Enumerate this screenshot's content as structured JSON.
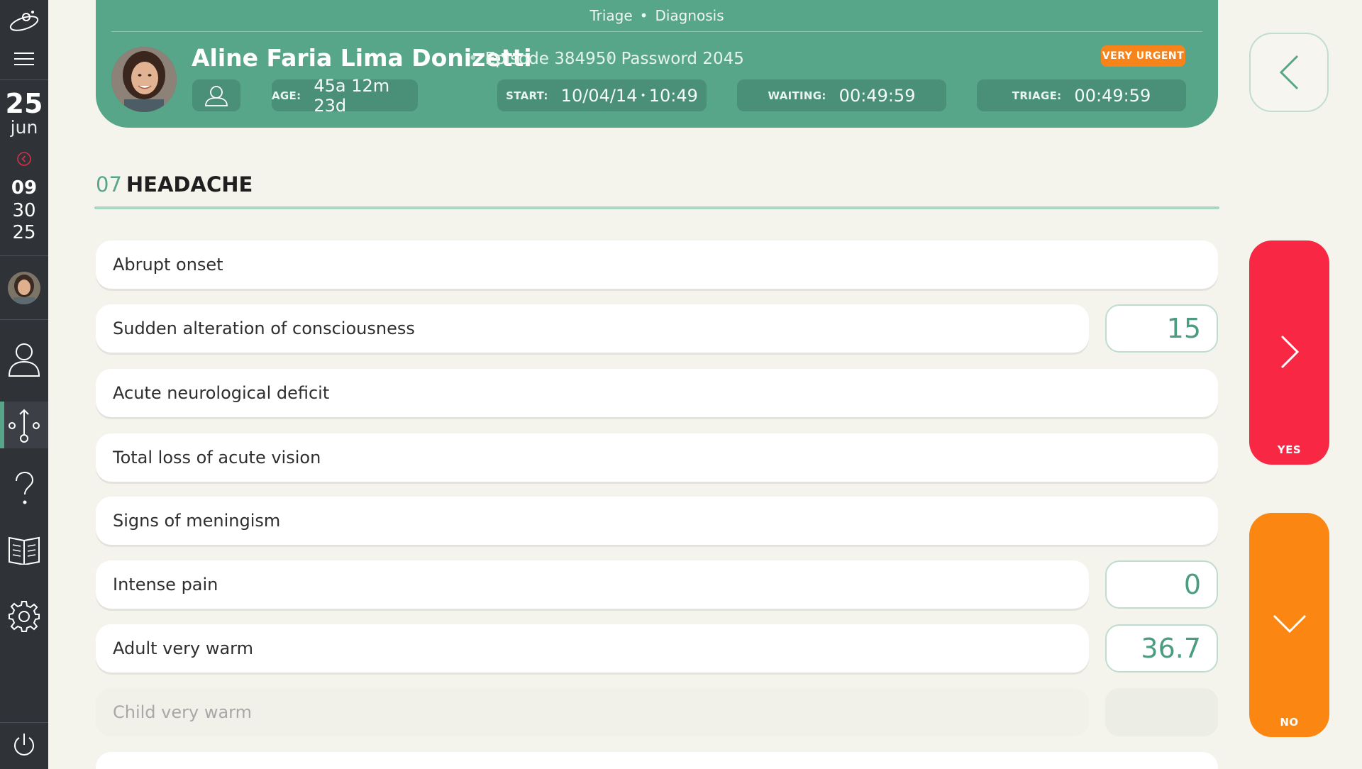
{
  "sidebar": {
    "date": {
      "day": "25",
      "month": "jun"
    },
    "time": {
      "hours": "09",
      "minutes": "30",
      "seconds": "25"
    }
  },
  "header": {
    "breadcrumb": {
      "part1": "Triage",
      "separator": "•",
      "part2": "Diagnosis"
    },
    "patient_name": "Aline Faria Lima Donizetti",
    "episode": "Episode 384950",
    "password": "Password 2045",
    "separator": "•",
    "urgency": "VERY URGENT",
    "age_label": "AGE:",
    "age_value": "45a 12m 23d",
    "start_label": "START:",
    "start_date": "10/04/14",
    "start_sep": "•",
    "start_time": "10:49",
    "waiting_label": "WAITING:",
    "waiting_value": "00:49:59",
    "triage_label": "TRIAGE:",
    "triage_value": "00:49:59"
  },
  "section": {
    "number": "07",
    "title": "HEADACHE"
  },
  "criteria": [
    {
      "label": "Abrupt onset"
    },
    {
      "label": "Sudden alteration of consciousness",
      "value": "15"
    },
    {
      "label": "Acute neurological deficit"
    },
    {
      "label": "Total loss of acute vision"
    },
    {
      "label": "Signs of meningism"
    },
    {
      "label": "Intense pain",
      "value": "0"
    },
    {
      "label": "Adult very warm",
      "value": "36.7"
    },
    {
      "label": "Child very warm"
    }
  ],
  "actions": {
    "yes_label": "YES",
    "no_label": "NO"
  },
  "colors": {
    "accent": "#58a68a",
    "urgent": "#f7831b",
    "yes": "#f82743",
    "no": "#fb8611",
    "sidebar": "#2f3237"
  }
}
